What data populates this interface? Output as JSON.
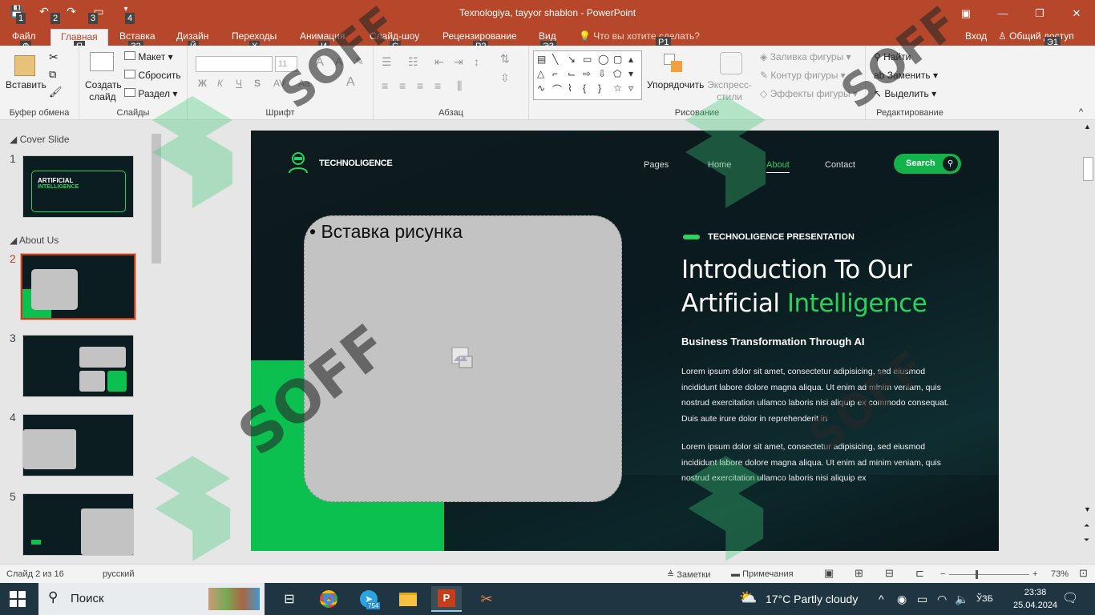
{
  "window": {
    "title": "Texnologiya, tayyor shablon - PowerPoint",
    "signin": "Вход",
    "share": "Общий доступ"
  },
  "qat_keytips": [
    "1",
    "2",
    "3",
    "4"
  ],
  "tabs": [
    {
      "label": "Файл",
      "keytip": "Ф"
    },
    {
      "label": "Главная",
      "keytip": "Я"
    },
    {
      "label": "Вставка",
      "keytip": "З2"
    },
    {
      "label": "Дизайн",
      "keytip": "Й"
    },
    {
      "label": "Переходы",
      "keytip": "Х"
    },
    {
      "label": "Анимация",
      "keytip": "И"
    },
    {
      "label": "Слайд-шоу",
      "keytip": "С"
    },
    {
      "label": "Рецензирование",
      "keytip": "Р2"
    },
    {
      "label": "Вид",
      "keytip": "Э3"
    }
  ],
  "tellme": "Что вы хотите сделать?",
  "share_keytip": "Э1",
  "draw_keytip": "Р1",
  "ribbon": {
    "clipboard": {
      "paste": "Вставить",
      "label": "Буфер обмена"
    },
    "slides": {
      "new_slide": "Создать слайд",
      "layout": "Макет",
      "reset": "Сбросить",
      "section": "Раздел",
      "label": "Слайды"
    },
    "font": {
      "label": "Шрифт",
      "bold": "Ж",
      "italic": "К",
      "underline": "Ч",
      "strike": "S",
      "size": "11"
    },
    "paragraph": {
      "label": "Абзац"
    },
    "drawing": {
      "arrange": "Упорядочить",
      "quick_styles": "Экспресс-стили",
      "fill": "Заливка фигуры",
      "outline": "Контур фигуры",
      "effects": "Эффекты фигуры",
      "label": "Рисование"
    },
    "editing": {
      "find": "Найти",
      "replace": "Заменить",
      "select": "Выделить",
      "label": "Редактирование"
    }
  },
  "thumbnails": {
    "sections": [
      "Cover Slide",
      "About Us"
    ],
    "numbers": [
      "1",
      "2",
      "3",
      "4",
      "5"
    ],
    "slide1_title": "ARTIFICIAL",
    "slide1_sub": "INTELLIGENCE"
  },
  "slide": {
    "logo": "TECHNOLIGENCE",
    "nav": [
      "Pages",
      "Home",
      "About",
      "Contact"
    ],
    "search": "Search",
    "placeholder": "Вставка рисунка",
    "pres_label": "TECHNOLIGENCE PRESENTATION",
    "heading_line1": "Introduction To Our",
    "heading_line2a": "Artificial",
    "heading_line2b": "Intelligence",
    "subheading": "Business Transformation Through AI",
    "para1": "Lorem ipsum dolor sit amet, consectetur adipisicing, sed eiusmod incididunt labore dolore magna aliqua. Ut enim ad minim veniam, quis nostrud exercitation ullamco laboris nisi aliquip ex commodo consequat. Duis aute irure dolor in reprehenderit in",
    "para2": "Lorem ipsum dolor sit amet, consectetur adipisicing, sed eiusmod incididunt labore dolore magna aliqua. Ut enim ad minim veniam, quis nostrud exercitation ullamco laboris nisi aliquip ex"
  },
  "watermark": "SOFF",
  "status": {
    "slide": "Слайд 2 из 16",
    "lang": "русский",
    "notes": "Заметки",
    "comments": "Примечания",
    "zoom": "73%"
  },
  "taskbar": {
    "search": "Поиск",
    "weather": "17°C  Partly cloudy",
    "lang": "ЎЗБ",
    "time": "23:38",
    "date": "25.04.2024",
    "telegram_badge": "754"
  },
  "colors": {
    "accent": "#b7472a",
    "green": "#26d35c",
    "slide_bg": "#0e1b1f"
  }
}
